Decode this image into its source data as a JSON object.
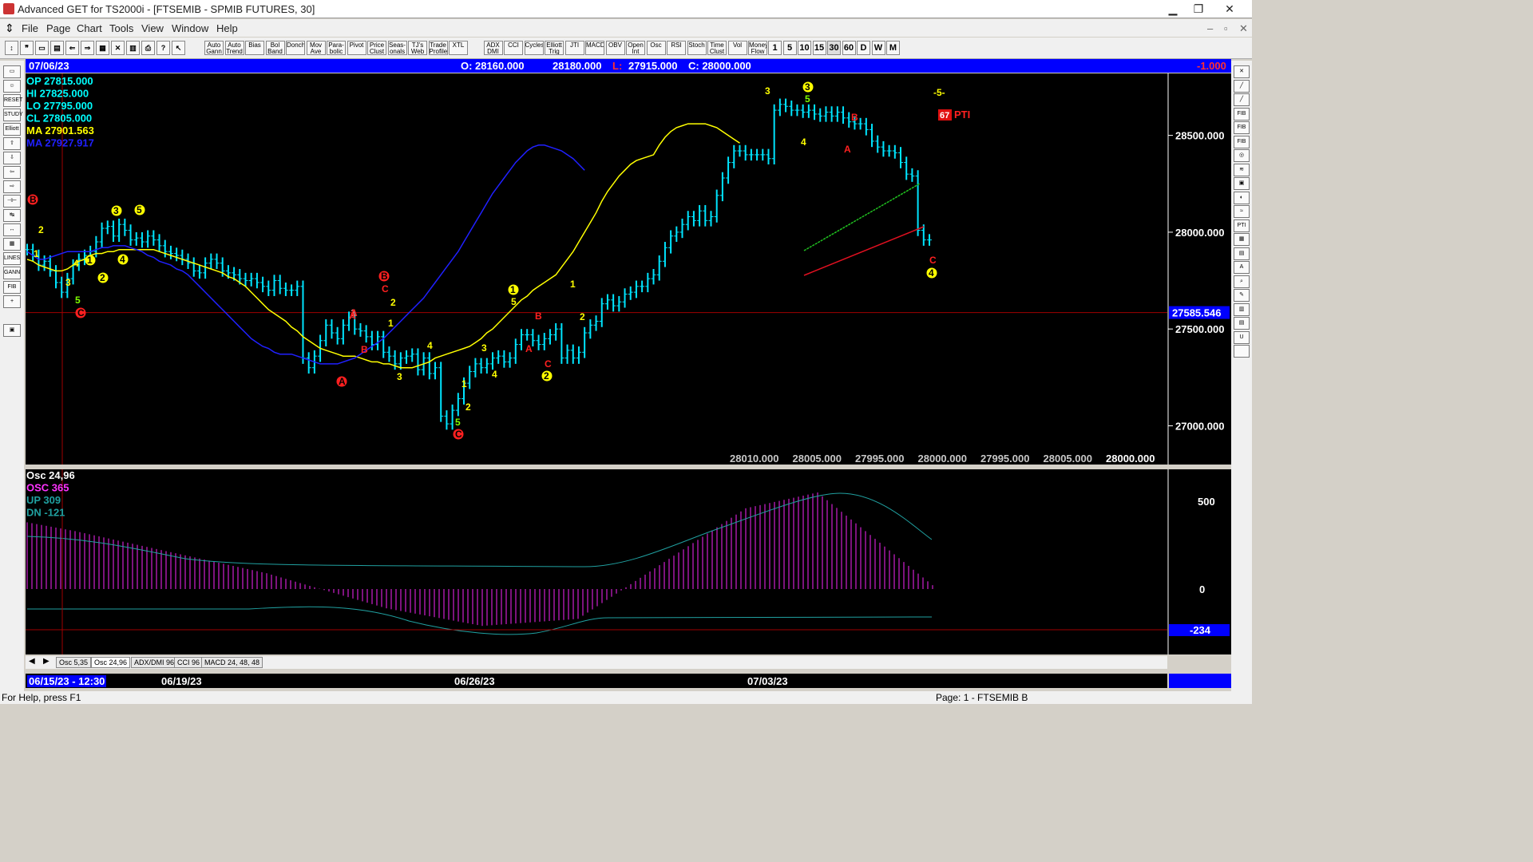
{
  "window": {
    "title": "Advanced GET for TS2000i - [FTSEMIB - SPMIB FUTURES, 30]",
    "minimize": "▁",
    "restore": "❐",
    "close": "✕"
  },
  "menu": [
    "File",
    "Page",
    "Chart",
    "Tools",
    "View",
    "Window",
    "Help"
  ],
  "toolbar": {
    "tools": [
      "Auto Gann",
      "Auto Trend",
      "Bias",
      "Bol Band",
      "Donch",
      "Mov Ave",
      "Para- bolic",
      "Pivot",
      "Price Clust",
      "Seas- onals",
      "TJ's Web",
      "Trade Profile",
      "XTL",
      "ADX DMI",
      "CCI",
      "Cycles",
      "Elliott Trig",
      "JTI",
      "MACD",
      "OBV",
      "Open Int",
      "Osc",
      "RSI",
      "Stoch",
      "Time Clust",
      "Vol",
      "Money Flow"
    ],
    "intervals": [
      "1",
      "5",
      "10",
      "15",
      "30",
      "60",
      "D",
      "W",
      "M"
    ]
  },
  "infobar": {
    "date": "07/06/23",
    "open": "O: 28160.000",
    "high": "28180.000",
    "low_label": "L:",
    "low": "27915.000",
    "close": "C: 28000.000",
    "change": "-1.000"
  },
  "legend": [
    {
      "label": "OP  27815.000",
      "color": "#00ffff"
    },
    {
      "label": "HI   27825.000",
      "color": "#00ffff"
    },
    {
      "label": "LO  27795.000",
      "color": "#00ffff"
    },
    {
      "label": "CL  27805.000",
      "color": "#00ffff"
    },
    {
      "label": "MA  27901.563",
      "color": "#ffff00"
    },
    {
      "label": "MA  27927.917",
      "color": "#2020ff"
    }
  ],
  "price_axis": [
    "28500.000",
    "28000.000",
    "27500.000",
    "27000.000"
  ],
  "price_marker": "27585.546",
  "bottom_values": [
    "28010.000",
    "28005.000",
    "27995.000",
    "28000.000",
    "27995.000",
    "28005.000",
    "28000.000"
  ],
  "pti": {
    "value": "67",
    "label": "PTI",
    "wave": "-5-"
  },
  "osc_legend": [
    {
      "label": "Osc 24,96",
      "color": "#ffffff"
    },
    {
      "label": "OSC 365",
      "color": "#ff33ff"
    },
    {
      "label": "UP   309",
      "color": "#20a0a0"
    },
    {
      "label": "DN   -121",
      "color": "#20a0a0"
    }
  ],
  "osc_axis": [
    "500",
    "0"
  ],
  "osc_marker": "-234",
  "tabs": [
    "Osc 5,35",
    "Osc 24,96",
    "ADX/DMI 96",
    "CCI 96",
    "MACD 24, 48, 48"
  ],
  "dates": [
    "06/15/23 - 12:30",
    "06/19/23",
    "06/26/23",
    "07/03/23"
  ],
  "status": {
    "left": "For Help, press F1",
    "right": "Page: 1 - FTSEMIB B"
  },
  "chart_data": {
    "type": "line",
    "ylim": [
      26800,
      28820
    ],
    "x_count": 145,
    "close": [
      27910,
      27880,
      27830,
      27850,
      27800,
      27740,
      27690,
      27760,
      27830,
      27860,
      27880,
      27900,
      27950,
      28020,
      28030,
      27980,
      28040,
      28010,
      27960,
      27970,
      27950,
      27980,
      27960,
      27930,
      27900,
      27890,
      27880,
      27860,
      27840,
      27800,
      27790,
      27840,
      27860,
      27840,
      27800,
      27790,
      27780,
      27760,
      27750,
      27760,
      27740,
      27720,
      27700,
      27750,
      27710,
      27700,
      27700,
      27720,
      27350,
      27300,
      27360,
      27440,
      27520,
      27480,
      27450,
      27520,
      27560,
      27500,
      27490,
      27460,
      27420,
      27460,
      27380,
      27360,
      27320,
      27350,
      27360,
      27370,
      27290,
      27350,
      27270,
      27300,
      27050,
      27010,
      27080,
      27140,
      27220,
      27280,
      27320,
      27300,
      27320,
      27350,
      27360,
      27330,
      27350,
      27420,
      27470,
      27470,
      27440,
      27420,
      27450,
      27470,
      27500,
      27350,
      27390,
      27350,
      27380,
      27480,
      27520,
      27540,
      27630,
      27650,
      27620,
      27640,
      27680,
      27690,
      27720,
      27720,
      27760,
      27780,
      27850,
      27920,
      27980,
      28000,
      28040,
      28080,
      28060,
      28110,
      28060,
      28080,
      28190,
      28280,
      28360,
      28420,
      28420,
      28400,
      28400,
      28400,
      28400,
      28380,
      28630,
      28660,
      28650,
      28630,
      28630,
      28620,
      28630,
      28610,
      28600,
      28620,
      28600,
      28620,
      28590,
      28570,
      28560,
      28560,
      28530,
      28470,
      28440,
      28420,
      28420,
      28410,
      28360,
      28300,
      28290,
      28010,
      27960,
      27960
    ],
    "ma_fast": [
      27860,
      27850,
      27830,
      27820,
      27810,
      27800,
      27800,
      27810,
      27830,
      27850,
      27860,
      27880,
      27890,
      27890,
      27900,
      27900,
      27910,
      27910,
      27910,
      27910,
      27910,
      27910,
      27910,
      27900,
      27890,
      27880,
      27870,
      27860,
      27850,
      27840,
      27830,
      27820,
      27810,
      27800,
      27790,
      27770,
      27760,
      27740,
      27720,
      27690,
      27660,
      27630,
      27600,
      27580,
      27560,
      27540,
      27510,
      27490,
      27460,
      27440,
      27420,
      27400,
      27390,
      27380,
      27370,
      27360,
      27360,
      27360,
      27350,
      27340,
      27330,
      27330,
      27320,
      27320,
      27310,
      27300,
      27300,
      27300,
      27310,
      27320,
      27330,
      27350,
      27360,
      27370,
      27380,
      27390,
      27400,
      27410,
      27430,
      27450,
      27480,
      27500,
      27530,
      27560,
      27590,
      27620,
      27650,
      27670,
      27700,
      27720,
      27740,
      27760,
      27780,
      27820,
      27860,
      27900,
      27950,
      28000,
      28050,
      28100,
      28160,
      28210,
      28250,
      28290,
      28320,
      28350,
      28370,
      28380,
      28390,
      28400,
      28450,
      28490,
      28520,
      28540,
      28550,
      28560,
      28560,
      28560,
      28560,
      28550,
      28540,
      28520,
      28500,
      28480,
      28460
    ],
    "ma_slow": [
      27900,
      27880,
      27860,
      27860,
      27870,
      27880,
      27890,
      27900,
      27900,
      27900,
      27900,
      27900,
      27910,
      27920,
      27920,
      27930,
      27930,
      27930,
      27920,
      27910,
      27900,
      27880,
      27870,
      27850,
      27840,
      27830,
      27810,
      27800,
      27780,
      27750,
      27720,
      27690,
      27660,
      27630,
      27600,
      27570,
      27540,
      27510,
      27480,
      27450,
      27430,
      27410,
      27400,
      27380,
      27370,
      27370,
      27370,
      27360,
      27350,
      27340,
      27330,
      27320,
      27320,
      27320,
      27320,
      27330,
      27340,
      27350,
      27370,
      27390,
      27410,
      27430,
      27450,
      27480,
      27510,
      27540,
      27570,
      27600,
      27630,
      27660,
      27700,
      27740,
      27780,
      27820,
      27860,
      27900,
      27950,
      28000,
      28050,
      28100,
      28150,
      28200,
      28240,
      28280,
      28320,
      28360,
      28390,
      28420,
      28440,
      28450,
      28450,
      28440,
      28430,
      28420,
      28400,
      28380,
      28350,
      28320
    ]
  }
}
